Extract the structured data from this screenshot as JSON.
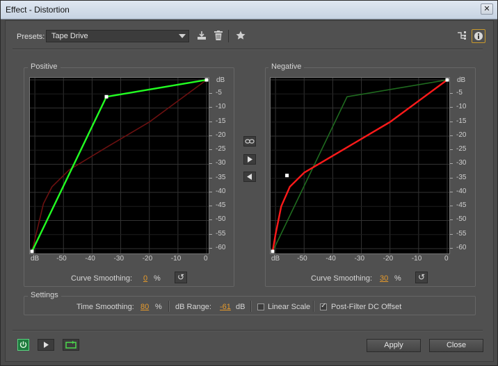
{
  "window": {
    "title": "Effect - Distortion",
    "close_glyph": "✕"
  },
  "presets": {
    "label": "Presets:",
    "value": "Tape Drive"
  },
  "toolbar": {
    "icons": [
      "download-preset-icon",
      "trash-icon",
      "star-icon",
      "routing-icon",
      "info-icon"
    ]
  },
  "positive": {
    "legend": "Positive",
    "curve_smoothing_label": "Curve Smoothing:",
    "curve_smoothing_value": "0",
    "unit": "%"
  },
  "negative": {
    "legend": "Negative",
    "curve_smoothing_label": "Curve Smoothing:",
    "curve_smoothing_value": "30",
    "unit": "%"
  },
  "axis": {
    "y_unit": "dB",
    "y_ticks": [
      "-5",
      "-10",
      "-15",
      "-20",
      "-25",
      "-30",
      "-35",
      "-40",
      "-45",
      "-50",
      "-55",
      "-60"
    ],
    "x_unit": "dB",
    "x_ticks": [
      "-50",
      "-40",
      "-30",
      "-20",
      "-10",
      "0"
    ]
  },
  "settings": {
    "legend": "Settings",
    "time_smoothing_label": "Time Smoothing:",
    "time_smoothing_value": "80",
    "time_smoothing_unit": "%",
    "db_range_label": "dB Range:",
    "db_range_value": "-61",
    "db_range_unit": "dB",
    "linear_scale_label": "Linear Scale",
    "linear_scale_checked": false,
    "post_filter_label": "Post-Filter DC Offset",
    "post_filter_checked": true
  },
  "footer": {
    "apply_label": "Apply",
    "close_label": "Close"
  },
  "colors": {
    "positive_curve": "#22ff22",
    "negative_curve": "#ff1a1a",
    "dim_positive": "#1f6b1f",
    "dim_negative": "#6b1010",
    "accent_value": "#e69a2b"
  },
  "chart_data": [
    {
      "type": "line",
      "title": "Positive",
      "xlabel": "dB",
      "ylabel": "dB",
      "xlim": [
        -61,
        0
      ],
      "ylim": [
        -61,
        0
      ],
      "series": [
        {
          "name": "",
          "points": [
            [
              -61,
              -61
            ],
            [
              -35,
              -6
            ],
            [
              0,
              0
            ]
          ]
        }
      ],
      "reference_series": [
        {
          "name": "",
          "points": [
            [
              -61,
              -61
            ],
            [
              -57,
              -44
            ],
            [
              -54,
              -38
            ],
            [
              -48,
              -32
            ],
            [
              -35,
              -24
            ],
            [
              -20,
              -15
            ],
            [
              0,
              0
            ]
          ]
        }
      ]
    },
    {
      "type": "line",
      "title": "Negative",
      "xlabel": "dB",
      "ylabel": "dB",
      "xlim": [
        -61,
        0
      ],
      "ylim": [
        -61,
        0
      ],
      "series": [
        {
          "name": "",
          "points": [
            [
              -61,
              -61
            ],
            [
              -60,
              -55
            ],
            [
              -58,
              -45
            ],
            [
              -55,
              -38
            ],
            [
              -50,
              -33
            ],
            [
              -35,
              -24
            ],
            [
              -20,
              -15
            ],
            [
              0,
              0
            ]
          ]
        }
      ],
      "control_points": [
        [
          -61,
          -61
        ],
        [
          -56,
          -34
        ],
        [
          0,
          0
        ]
      ],
      "reference_series": [
        {
          "name": "",
          "points": [
            [
              -61,
              -61
            ],
            [
              -35,
              -6
            ],
            [
              0,
              0
            ]
          ]
        }
      ]
    }
  ]
}
